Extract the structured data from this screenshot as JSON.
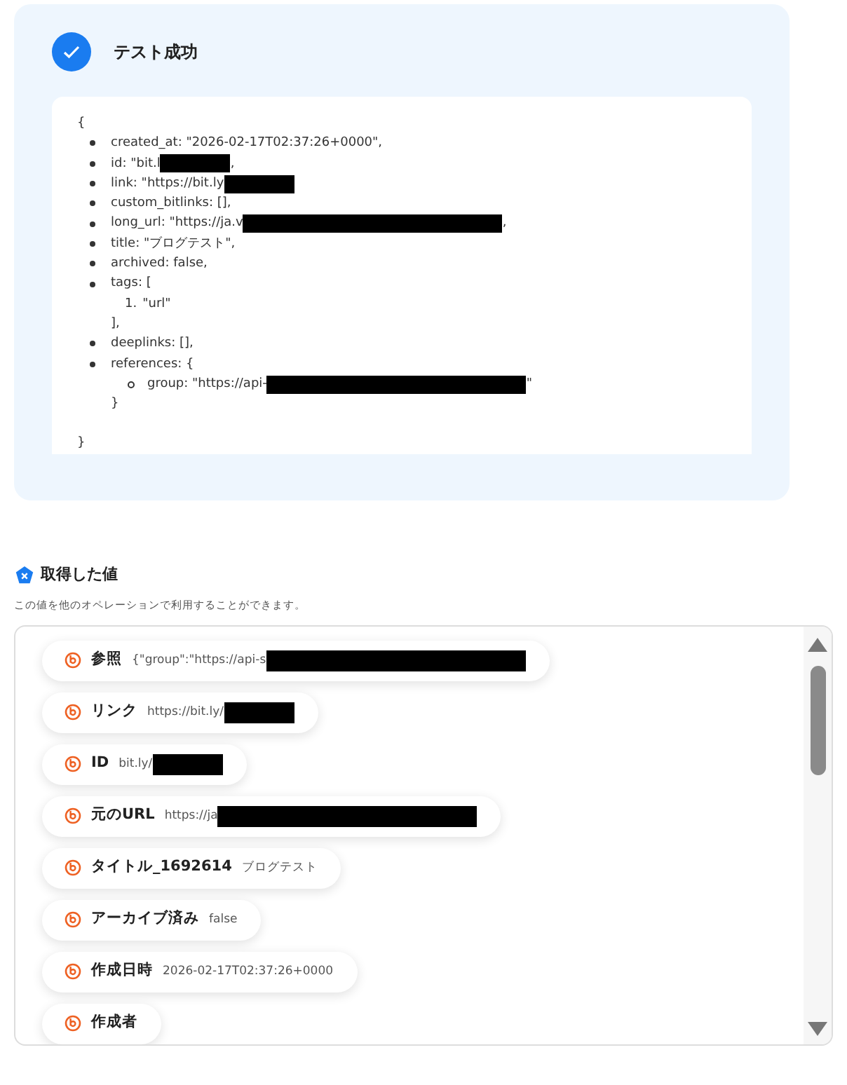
{
  "test_result": {
    "title": "テスト成功",
    "success": true,
    "json_lines": [
      {
        "kind": "open",
        "text": "{"
      },
      {
        "kind": "item",
        "text": "created_at: \"2026-02-17T02:37:26+0000\","
      },
      {
        "kind": "item",
        "text": "id: \"bit.l",
        "redacted": true,
        "suffix": ","
      },
      {
        "kind": "item",
        "text": "link: \"https://bit.ly",
        "redacted": true
      },
      {
        "kind": "item",
        "text": "custom_bitlinks: [],"
      },
      {
        "kind": "item",
        "text": "long_url: \"https://ja.v",
        "redacted": true,
        "wide": true,
        "suffix": ","
      },
      {
        "kind": "item",
        "text": "title: \"ブログテスト\","
      },
      {
        "kind": "item",
        "text": "archived: false,"
      },
      {
        "kind": "item",
        "text": "tags: ["
      },
      {
        "kind": "ordered",
        "marker": "1.",
        "text": "\"url\""
      },
      {
        "kind": "close",
        "text": "],"
      },
      {
        "kind": "item",
        "text": "deeplinks: [],"
      },
      {
        "kind": "item",
        "text": "references: {"
      },
      {
        "kind": "sub",
        "text": "group: \"https://api-",
        "redacted": true,
        "wide": true,
        "suffix": "\""
      },
      {
        "kind": "close",
        "text": "}"
      },
      {
        "kind": "end",
        "text": "}"
      }
    ]
  },
  "values_section": {
    "title": "取得した値",
    "description": "この値を他のオペレーションで利用することができます。",
    "items": [
      {
        "label": "参照",
        "value": "{\"group\":\"https://api-s",
        "redacted": true,
        "wide": true
      },
      {
        "label": "リンク",
        "value": "https://bit.ly/",
        "redacted": true
      },
      {
        "label": "ID",
        "value": "bit.ly/",
        "redacted": true
      },
      {
        "label": "元のURL",
        "value": "https://ja",
        "redacted": true,
        "wide": true
      },
      {
        "label": "タイトル_1692614",
        "value": "ブログテスト"
      },
      {
        "label": "アーカイブ済み",
        "value": "false"
      },
      {
        "label": "作成日時",
        "value": "2026-02-17T02:37:26+0000"
      },
      {
        "label": "作成者"
      }
    ]
  }
}
